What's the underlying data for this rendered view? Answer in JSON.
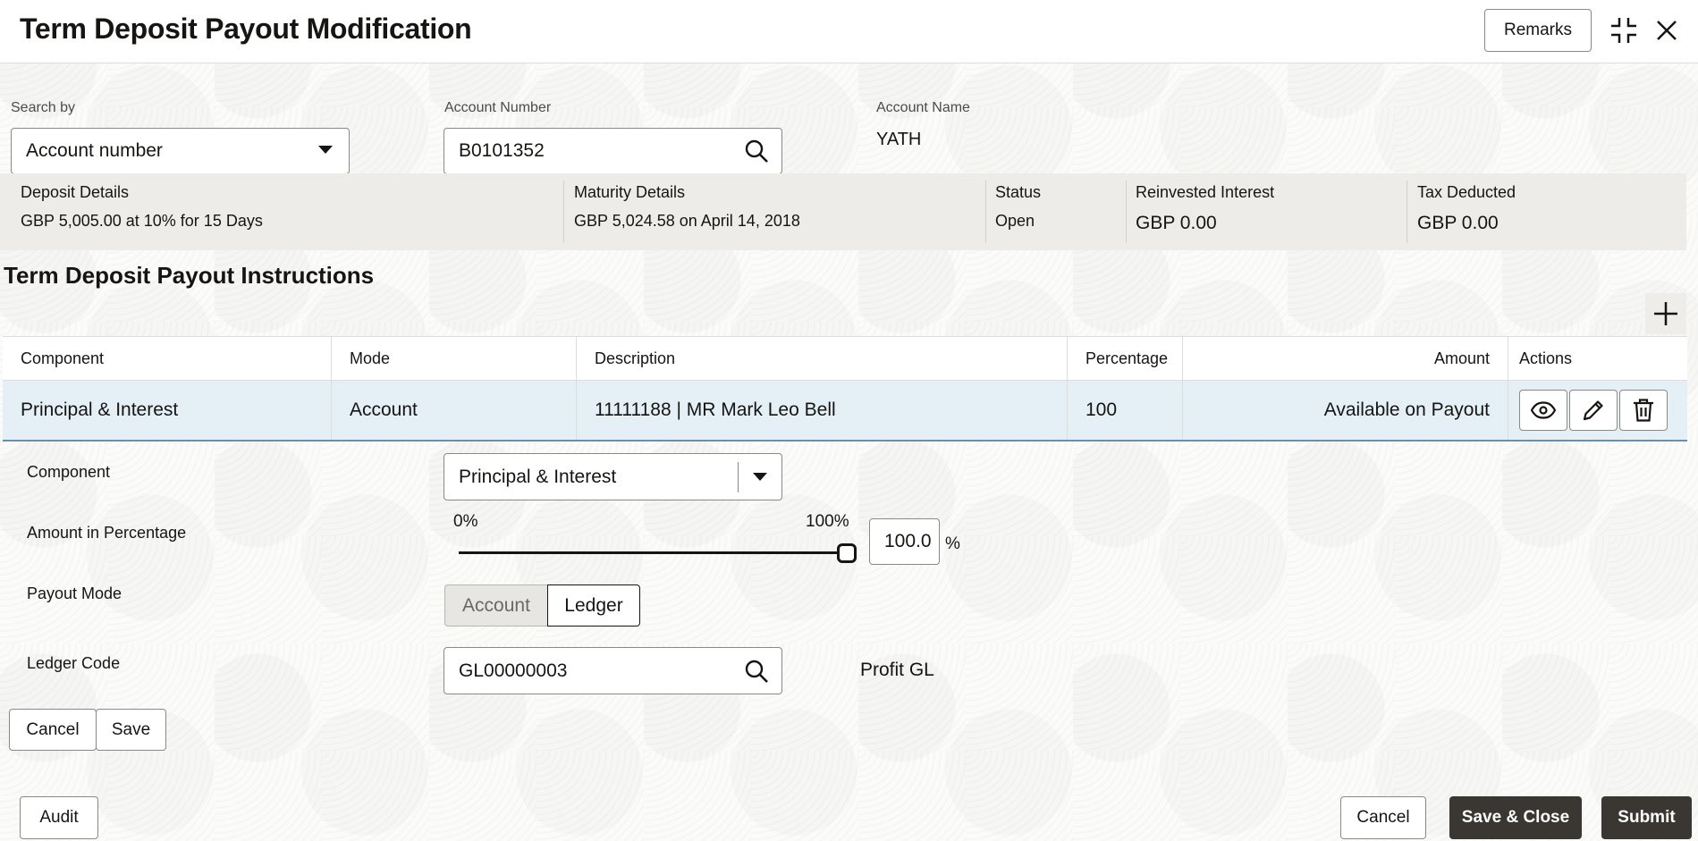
{
  "header": {
    "title": "Term Deposit Payout Modification",
    "remarks_label": "Remarks"
  },
  "search": {
    "search_by_label": "Search by",
    "search_by_value": "Account number",
    "account_number_label": "Account Number",
    "account_number_value": "B0101352",
    "account_name_label": "Account Name",
    "account_name_value": "YATH"
  },
  "summary": {
    "deposit_details_label": "Deposit Details",
    "deposit_details_value": "GBP 5,005.00 at 10% for 15 Days",
    "maturity_details_label": "Maturity Details",
    "maturity_details_value": "GBP 5,024.58 on April 14, 2018",
    "status_label": "Status",
    "status_value": "Open",
    "reinvested_interest_label": "Reinvested Interest",
    "reinvested_interest_value": "GBP 0.00",
    "tax_deducted_label": "Tax Deducted",
    "tax_deducted_value": "GBP 0.00"
  },
  "instructions": {
    "section_title": "Term Deposit Payout Instructions",
    "columns": [
      "Component",
      "Mode",
      "Description",
      "Percentage",
      "Amount",
      "Actions"
    ],
    "rows": [
      {
        "component": "Principal & Interest",
        "mode": "Account",
        "description": "11111188 | MR Mark Leo Bell",
        "percentage": "100",
        "amount": "Available on Payout"
      }
    ]
  },
  "form": {
    "component_label": "Component",
    "component_value": "Principal & Interest",
    "amount_pct_label": "Amount in Percentage",
    "slider_min_label": "0%",
    "slider_max_label": "100%",
    "slider_value_fraction": 1.0,
    "pct_input_value": "100.0",
    "pct_symbol": "%",
    "payout_mode_label": "Payout Mode",
    "payout_mode_options": [
      "Account",
      "Ledger"
    ],
    "payout_mode_selected": "Ledger",
    "ledger_code_label": "Ledger Code",
    "ledger_code_value": "GL00000003",
    "ledger_code_name": "Profit GL",
    "cancel_label": "Cancel",
    "save_label": "Save"
  },
  "footer": {
    "audit_label": "Audit",
    "cancel_label": "Cancel",
    "save_close_label": "Save & Close",
    "submit_label": "Submit"
  }
}
